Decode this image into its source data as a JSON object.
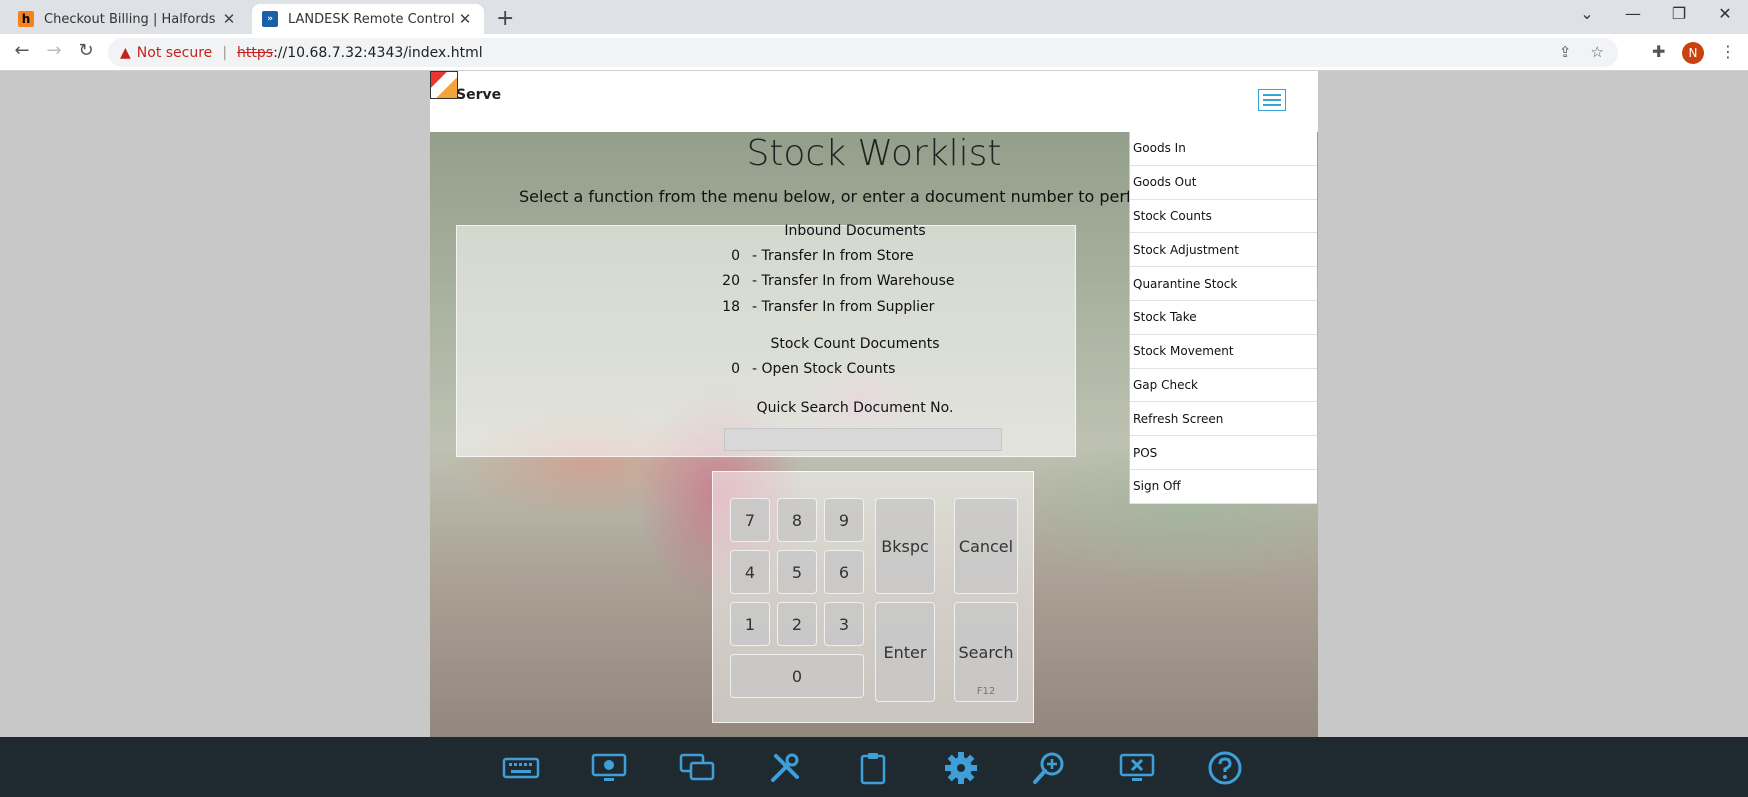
{
  "browser": {
    "tabs": [
      {
        "title": "Checkout Billing | Halfords UK",
        "favicon": "h"
      },
      {
        "title": "LANDESK Remote Control",
        "favicon": "»"
      }
    ],
    "security_label": "Not secure",
    "url_scheme": "https",
    "url_rest": "://10.68.7.32:4343/index.html",
    "profile_initial": "N"
  },
  "app": {
    "logo_text": "Serve",
    "title": "Stock Worklist",
    "instruction": "Select a function from the menu below, or enter a document number to perform a",
    "inbound": {
      "heading": "Inbound Documents",
      "rows": [
        {
          "count": "0",
          "label": "- Transfer In from Store"
        },
        {
          "count": "20",
          "label": "- Transfer In from Warehouse"
        },
        {
          "count": "18",
          "label": "- Transfer In from Supplier"
        }
      ]
    },
    "stock_count": {
      "heading": "Stock Count Documents",
      "rows": [
        {
          "count": "0",
          "label": "-  Open Stock Counts"
        }
      ]
    },
    "quick_search_label": "Quick Search Document No.",
    "keypad": {
      "k7": "7",
      "k8": "8",
      "k9": "9",
      "k4": "4",
      "k5": "5",
      "k6": "6",
      "k1": "1",
      "k2": "2",
      "k3": "3",
      "k0": "0",
      "backspace": "Bkspc",
      "cancel": "Cancel",
      "enter": "Enter",
      "search": "Search",
      "search_hint": "F12"
    },
    "menu": [
      "Goods In",
      "Goods Out",
      "Stock Counts",
      "Stock Adjustment",
      "Quarantine Stock",
      "Stock Take",
      "Stock Movement",
      "Gap Check",
      "Refresh Screen",
      "POS",
      "Sign Off"
    ]
  },
  "toolbar_icons": [
    "keyboard-icon",
    "screenshot-icon",
    "display-icon",
    "tools-icon",
    "clipboard-icon",
    "settings-icon",
    "zoom-icon",
    "disconnect-icon",
    "help-icon"
  ],
  "colors": {
    "accent": "#3aa3d6",
    "toolbar_bg": "#1f2a30",
    "toolbar_icon": "#3f9fd9",
    "warning": "#c5221f"
  }
}
